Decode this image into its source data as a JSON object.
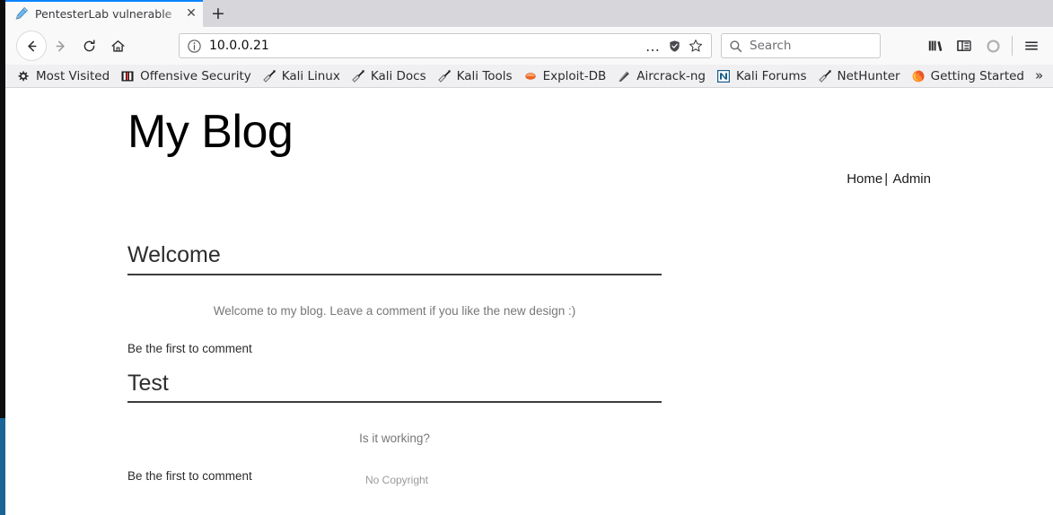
{
  "browser": {
    "tab": {
      "title": "PentesterLab vulnerable",
      "favicon_name": "pencil-icon",
      "close_label": "✕"
    },
    "newtab_label": "+",
    "nav": {
      "back_label": "←",
      "forward_label": "→",
      "reload_label": "↻",
      "home_label": "⌂"
    },
    "urlbar": {
      "identity_icon": "info-icon",
      "url": "10.0.0.21",
      "page_actions_label": "…",
      "tracking_icon": "shield-icon",
      "bookmark_icon": "star-icon"
    },
    "search": {
      "icon": "search-icon",
      "placeholder": "Search"
    },
    "toolbar_right": [
      {
        "name": "library-icon",
        "label": "Library"
      },
      {
        "name": "sidebar-icon",
        "label": "Sidebars"
      },
      {
        "name": "account-icon",
        "label": "Account"
      },
      {
        "name": "menu-icon",
        "label": "Open menu"
      }
    ],
    "bookmarks": [
      {
        "label": "Most Visited",
        "icon": "gear-icon"
      },
      {
        "label": "Offensive Security",
        "icon": "offensive-security-icon"
      },
      {
        "label": "Kali Linux",
        "icon": "kali-dragon-icon"
      },
      {
        "label": "Kali Docs",
        "icon": "kali-dragon-icon"
      },
      {
        "label": "Kali Tools",
        "icon": "kali-dragon-icon"
      },
      {
        "label": "Exploit-DB",
        "icon": "exploitdb-icon"
      },
      {
        "label": "Aircrack-ng",
        "icon": "aircrack-icon"
      },
      {
        "label": "Kali Forums",
        "icon": "kali-forums-icon"
      },
      {
        "label": "NetHunter",
        "icon": "kali-dragon-icon"
      },
      {
        "label": "Getting Started",
        "icon": "firefox-icon"
      }
    ],
    "bookmarks_overflow_label": "»"
  },
  "page": {
    "site_title": "My Blog",
    "nav": {
      "home": "Home",
      "separator": "|",
      "admin": "Admin"
    },
    "posts": [
      {
        "title": "Welcome",
        "body": "Welcome to my blog. Leave a comment if you like the new design :)",
        "comment_link": "Be the first to comment"
      },
      {
        "title": "Test",
        "body": "Is it working?",
        "comment_link": "Be the first to comment"
      }
    ],
    "footer": "No Copyright"
  },
  "colors": {
    "tab_accent": "#0a84ff",
    "chrome_bg": "#f9f9fa",
    "tabstrip_bg": "#d7d7db",
    "bookmarks_bg": "#f0f0f2",
    "post_rule": "#3c3c3c",
    "body_text": "#777777"
  }
}
